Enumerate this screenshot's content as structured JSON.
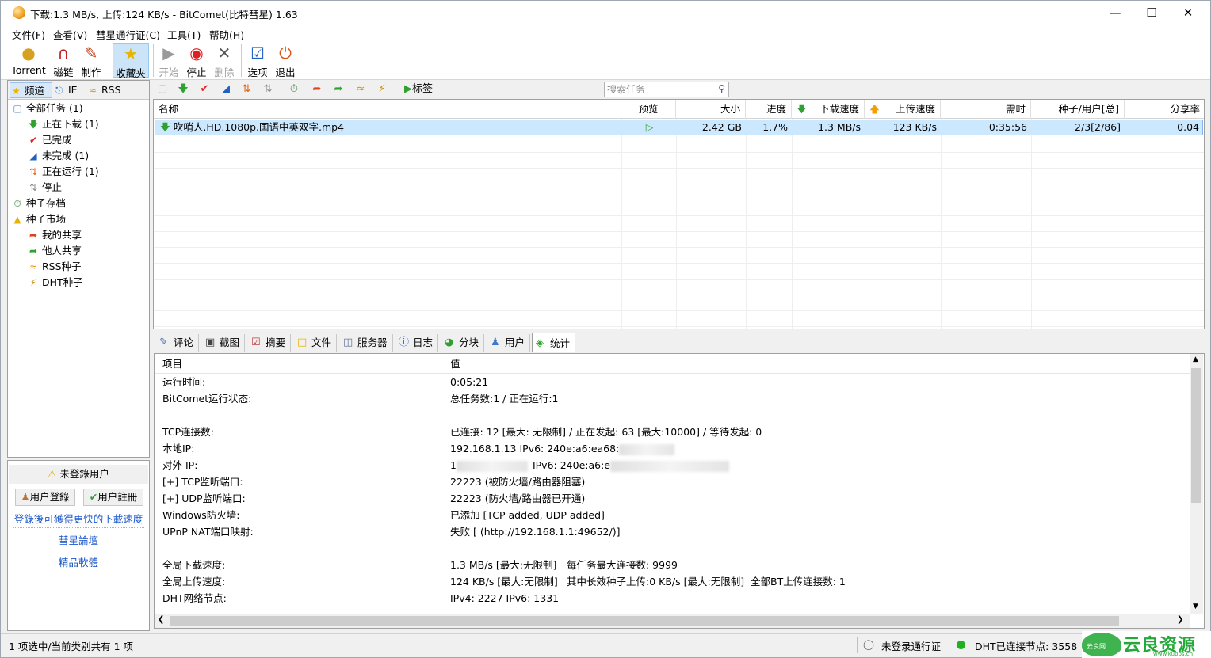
{
  "window": {
    "title": "下载:1.3 MB/s, 上传:124 KB/s - BitComet(比特彗星) 1.63",
    "minimize": "—",
    "maximize": "☐",
    "close": "✕"
  },
  "menu": [
    "文件(F)",
    "查看(V)",
    "彗星通行证(C)",
    "工具(T)",
    "帮助(H)"
  ],
  "toolbar": {
    "torrent": "Torrent",
    "magnet": "磁链",
    "make": "制作",
    "favorites": "收藏夹",
    "start": "开始",
    "stop": "停止",
    "delete": "删除",
    "options": "选项",
    "exit": "退出"
  },
  "left_tabs": [
    "频道",
    "IE",
    "RSS"
  ],
  "tree": {
    "all": "全部任务 (1)",
    "downloading": "正在下载 (1)",
    "completed": "已完成",
    "incomplete": "未完成 (1)",
    "running": "正在运行 (1)",
    "stopped": "停止",
    "archive": "种子存档",
    "market": "种子市场",
    "my_share": "我的共享",
    "others_share": "他人共享",
    "rss_seed": "RSS种子",
    "dht_seed": "DHT种子"
  },
  "account": {
    "not_logged": "未登錄用户",
    "login": "用户登錄",
    "register": "用户註冊",
    "promo": "登錄後可獲得更快的下載速度",
    "forum": "彗星論壇",
    "software": "精品軟體"
  },
  "list_toolbar": {
    "tags": "标签",
    "search_placeholder": "搜索任务"
  },
  "columns": [
    "名称",
    "预览",
    "大小",
    "进度",
    "下载速度",
    "上传速度",
    "需时",
    "种子/用户[总]",
    "分享率"
  ],
  "task": {
    "name": "吹哨人.HD.1080p.国语中英双字.mp4",
    "preview": "▷",
    "size": "2.42 GB",
    "progress": "1.7%",
    "down_speed": "1.3 MB/s",
    "up_speed": "123 KB/s",
    "eta": "0:35:56",
    "seeds_peers": "2/3[2/86]",
    "ratio": "0.04"
  },
  "detail_tabs": [
    "评论",
    "截图",
    "摘要",
    "文件",
    "服务器",
    "日志",
    "分块",
    "用户",
    "统计"
  ],
  "stats": {
    "header_item": "项目",
    "header_value": "值",
    "rows": [
      {
        "k": "运行时间:",
        "v": "0:05:21"
      },
      {
        "k": "BitComet运行状态:",
        "v": "总任务数:1 / 正在运行:1"
      },
      {
        "k": "TCP连接数:",
        "v": "已连接: 12 [最大: 无限制] / 正在发起: 63 [最大:10000] / 等待发起: 0"
      },
      {
        "k": "本地IP:",
        "v": "192.168.1.13    IPv6: 240e:a6:ea68:"
      },
      {
        "k": "对外 IP:",
        "v": "1",
        "v2": "IPv6: 240e:a6:e"
      },
      {
        "k": "[+] TCP监听端口:",
        "v": "22223 (被防火墙/路由器阻塞)"
      },
      {
        "k": "[+] UDP监听端口:",
        "v": "22223 (防火墙/路由器已开通)"
      },
      {
        "k": "Windows防火墙:",
        "v": "已添加 [TCP added, UDP added]"
      },
      {
        "k": "UPnP NAT端口映射:",
        "v": "失败 [ (http://192.168.1.1:49652/)]"
      },
      {
        "k": "全局下载速度:",
        "v": "1.3 MB/s [最大:无限制]",
        "v2": "每任务最大连接数: 9999"
      },
      {
        "k": "全局上传速度:",
        "v": "124 KB/s [最大:无限制]",
        "v2": "其中长效种子上传:0 KB/s [最大:无限制]",
        "v3": "全部BT上传连接数: 1"
      },
      {
        "k": "DHT网络节点:",
        "v": "IPv4: 2227  IPv6: 1331"
      }
    ]
  },
  "status": {
    "selection": "1 项选中/当前类别共有 1 项",
    "pass": "未登录通行证",
    "dht": "DHT已连接节点: 3558"
  },
  "watermark": {
    "brand": "云良资源网",
    "site": "www.kubbs.cn",
    "badge": "云良网"
  },
  "colors": {
    "selection": "#cce8ff",
    "link": "#1a56c8",
    "watermark": "#25a83a"
  }
}
